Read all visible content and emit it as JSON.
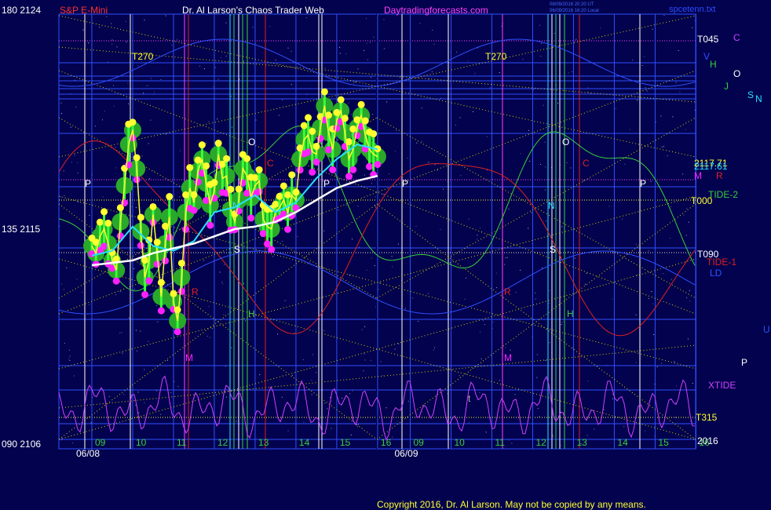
{
  "header": {
    "left_scale": "180  2124",
    "instrument": "S&P E-Mini",
    "title": "Dr. Al Larson's Chaos Trader Web",
    "site": "Daytradingforecasts.com",
    "timestamp_1": "06/09/2016 20:20 UT",
    "timestamp_2": "06/09/2016 16:20 Local",
    "file": "spcetenn.txt"
  },
  "left_axis": {
    "top": "180  2124",
    "mid": "135  2115",
    "bottom": "090  2106"
  },
  "footer": {
    "copyright": "Copyright 2016, Dr. Al Larson. May not be copied by any means."
  },
  "colors": {
    "background": "#02024e",
    "grid_blue": "#3050ff",
    "gold_diag": "#d8d000",
    "price_yellow": "#ffff30",
    "price_magenta": "#ff20ff",
    "halo_green": "#2aa82a",
    "avg_cyan": "#28e0ff",
    "avg_white": "#ffffff",
    "tide_green": "#3ad03a",
    "tide_red": "#e02020",
    "xtide": "#d040ff"
  },
  "chart_data": {
    "type": "line",
    "title": "S&P E-Mini",
    "x_label": "",
    "y_label": "",
    "ylim": [
      2106,
      2124
    ],
    "days": [
      "06/08",
      "06/09"
    ],
    "hour_ticks": [
      "09",
      "10",
      "11",
      "12",
      "13",
      "14",
      "15",
      "16"
    ],
    "series": [
      {
        "name": "S&P E-Mini",
        "color": "#ffff30",
        "x": [
          9.0,
          9.1,
          9.2,
          9.3,
          9.4,
          9.5,
          9.6,
          9.7,
          9.8,
          9.9,
          10.0,
          10.1,
          10.2,
          10.3,
          10.4,
          10.5,
          10.6,
          10.7,
          10.8,
          10.9,
          11.0,
          11.1,
          11.2,
          11.3,
          11.4,
          11.5,
          11.6,
          11.7,
          11.8,
          11.9,
          12.0,
          12.1,
          12.2,
          12.3,
          12.4,
          12.5,
          12.6,
          12.7,
          12.8,
          12.9,
          13.0,
          13.1,
          13.2,
          13.3,
          13.4,
          13.5,
          13.6,
          13.7,
          13.8,
          13.9,
          14.0,
          14.1,
          14.2,
          14.3,
          14.4,
          14.5,
          14.6,
          14.7,
          14.8,
          14.9,
          15.0,
          15.1,
          15.2,
          15.3,
          15.4,
          15.5,
          15.6,
          15.7,
          15.8,
          15.9,
          16.0
        ],
        "values": [
          2114.4,
          2114.1,
          2114.8,
          2115.1,
          2114.5,
          2113.8,
          2113.4,
          2115.4,
          2116.9,
          2118.6,
          2119.2,
          2117.6,
          2115.0,
          2113.1,
          2113.8,
          2115.7,
          2114.1,
          2112.3,
          2114.5,
          2115.6,
          2112.1,
          2111.3,
          2113.1,
          2115.8,
          2116.8,
          2116.2,
          2117.5,
          2118.0,
          2117.0,
          2116.1,
          2116.7,
          2118.2,
          2117.2,
          2117.3,
          2115.9,
          2115.4,
          2116.3,
          2117.6,
          2117.3,
          2116.4,
          2116.9,
          2117.1,
          2115.5,
          2115.2,
          2115.1,
          2115.8,
          2116.0,
          2116.3,
          2115.8,
          2116.5,
          2116.3,
          2118.0,
          2118.8,
          2119.0,
          2118.3,
          2118.2,
          2119.3,
          2120.2,
          2119.1,
          2118.4,
          2119.6,
          2120.0,
          2119.1,
          2118.0,
          2118.4,
          2119.3,
          2119.8,
          2119.0,
          2118.4,
          2118.2,
          2118.1
        ]
      },
      {
        "name": "average fast",
        "color": "#28e0ff",
        "x": [
          9.0,
          9.5,
          10.0,
          10.5,
          11.0,
          11.5,
          12.0,
          12.5,
          13.0,
          13.5,
          14.0,
          14.5,
          15.0,
          15.5,
          16.0
        ],
        "values": [
          2114.0,
          2114.2,
          2115.2,
          2114.4,
          2114.2,
          2114.6,
          2115.8,
          2116.0,
          2116.5,
          2115.8,
          2116.2,
          2117.2,
          2118.0,
          2118.6,
          2118.4
        ]
      },
      {
        "name": "average slow",
        "color": "#ffffff",
        "x": [
          9.0,
          9.5,
          10.0,
          10.5,
          11.0,
          11.5,
          12.0,
          12.5,
          13.0,
          13.5,
          14.0,
          14.5,
          15.0,
          15.5,
          16.0
        ],
        "values": [
          2113.6,
          2113.7,
          2113.8,
          2114.1,
          2114.3,
          2114.5,
          2114.8,
          2115.1,
          2115.2,
          2115.4,
          2115.8,
          2116.3,
          2116.8,
          2117.1,
          2117.3
        ]
      }
    ],
    "right_labels": [
      {
        "text": "T045",
        "color": "#ffffff"
      },
      {
        "text": "C",
        "color": "#d040ff"
      },
      {
        "text": "V",
        "color": "#3050ff"
      },
      {
        "text": "H",
        "color": "#3ad03a"
      },
      {
        "text": "O",
        "color": "#ffffff"
      },
      {
        "text": "J",
        "color": "#3ad03a"
      },
      {
        "text": "S",
        "color": "#28e0ff"
      },
      {
        "text": "N",
        "color": "#28e0ff"
      },
      {
        "text": "2117.71",
        "color": "#ffff30"
      },
      {
        "text": "2117.61",
        "color": "#28e0ff"
      },
      {
        "text": "M",
        "color": "#ff20ff"
      },
      {
        "text": "R",
        "color": "#e02020"
      },
      {
        "text": "TIDE-2",
        "color": "#3ad03a"
      },
      {
        "text": "T000",
        "color": "#ffff30"
      },
      {
        "text": "T090",
        "color": "#ffffff"
      },
      {
        "text": "TIDE-1",
        "color": "#e02020"
      },
      {
        "text": "LD",
        "color": "#3050ff"
      },
      {
        "text": "U",
        "color": "#3050ff"
      },
      {
        "text": "P",
        "color": "#ffffff"
      },
      {
        "text": "XTIDE",
        "color": "#d040ff"
      },
      {
        "text": "T315",
        "color": "#ffff30"
      },
      {
        "text": "2016",
        "color": "#ffffff"
      }
    ],
    "markers": [
      {
        "text": "T270",
        "color": "#ffff30"
      },
      {
        "text": "T270",
        "color": "#ffff30"
      },
      {
        "text": "P",
        "color": "#ffffff"
      },
      {
        "text": "P",
        "color": "#ffffff"
      },
      {
        "text": "P",
        "color": "#ffffff"
      },
      {
        "text": "P",
        "color": "#ffffff"
      },
      {
        "text": "O",
        "color": "#ffffff"
      },
      {
        "text": "O",
        "color": "#ffffff"
      },
      {
        "text": "C",
        "color": "#e02020"
      },
      {
        "text": "C",
        "color": "#e02020"
      },
      {
        "text": "N",
        "color": "#28e0ff"
      },
      {
        "text": "N",
        "color": "#28e0ff"
      },
      {
        "text": "S",
        "color": "#ffffff"
      },
      {
        "text": "S",
        "color": "#ffffff"
      },
      {
        "text": "H",
        "color": "#3ad03a"
      },
      {
        "text": "H",
        "color": "#3ad03a"
      },
      {
        "text": "R",
        "color": "#e02020"
      },
      {
        "text": "R",
        "color": "#e02020"
      },
      {
        "text": "M",
        "color": "#ff20ff"
      },
      {
        "text": "M",
        "color": "#ff20ff"
      },
      {
        "text": "t",
        "color": "#aaaaaa"
      }
    ]
  }
}
